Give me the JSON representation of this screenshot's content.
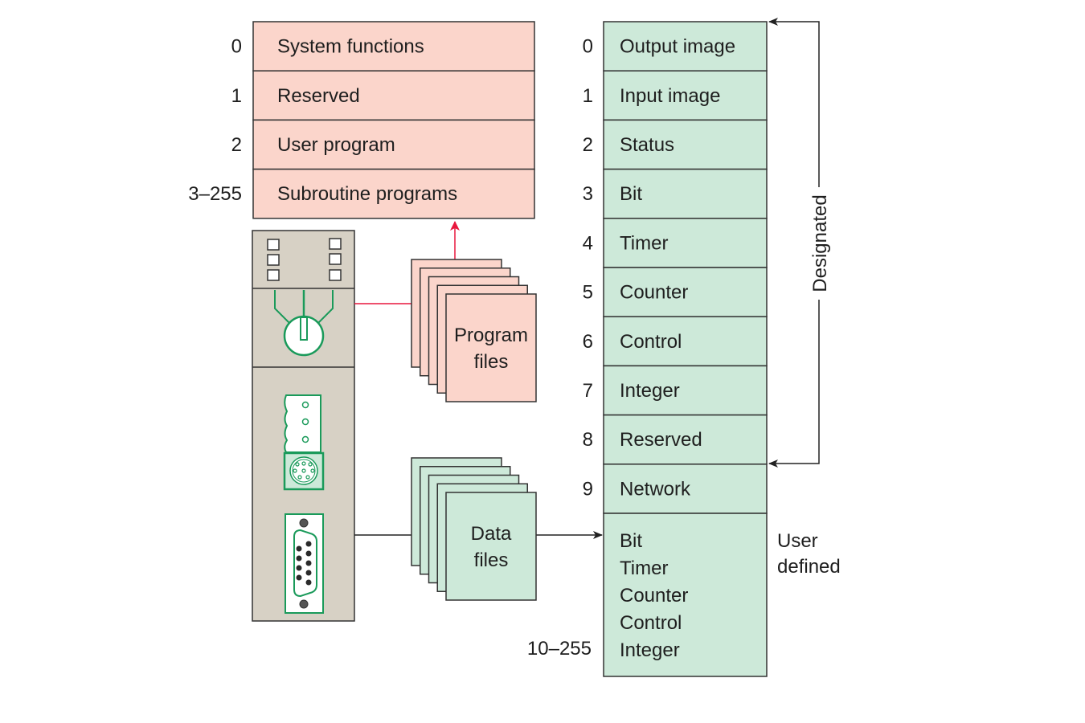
{
  "colors": {
    "program": "#fbd5cb",
    "data": "#cde9d9",
    "plc_body": "#d7d1c5",
    "plc_green": "#1a9a5a",
    "red_line": "#e8173d",
    "outline": "#333333",
    "text": "#1e1e1e"
  },
  "program_table": {
    "rows": [
      {
        "index": "0",
        "label": "System functions"
      },
      {
        "index": "1",
        "label": "Reserved"
      },
      {
        "index": "2",
        "label": "User program"
      },
      {
        "index": "3–255",
        "label": "Subroutine programs"
      }
    ]
  },
  "data_table": {
    "rows": [
      {
        "index": "0",
        "label": "Output image"
      },
      {
        "index": "1",
        "label": "Input image"
      },
      {
        "index": "2",
        "label": "Status"
      },
      {
        "index": "3",
        "label": "Bit"
      },
      {
        "index": "4",
        "label": "Timer"
      },
      {
        "index": "5",
        "label": "Counter"
      },
      {
        "index": "6",
        "label": "Control"
      },
      {
        "index": "7",
        "label": "Integer"
      },
      {
        "index": "8",
        "label": "Reserved"
      },
      {
        "index": "9",
        "label": "Network"
      }
    ],
    "user_block": {
      "index": "10–255",
      "items": [
        "Bit",
        "Timer",
        "Counter",
        "Control",
        "Integer"
      ]
    }
  },
  "program_files": {
    "line1": "Program",
    "line2": "files"
  },
  "data_files": {
    "line1": "Data",
    "line2": "files"
  },
  "brackets": {
    "designated": "Designated",
    "user_defined_line1": "User",
    "user_defined_line2": "defined"
  },
  "plc": {
    "led_icons": [
      "led-indicator",
      "led-indicator",
      "led-indicator",
      "led-indicator",
      "led-indicator",
      "led-indicator"
    ],
    "key_switch_icon": "key-switch",
    "ports": [
      "terminal-block",
      "mini-din-port",
      "db9-serial-port"
    ]
  }
}
